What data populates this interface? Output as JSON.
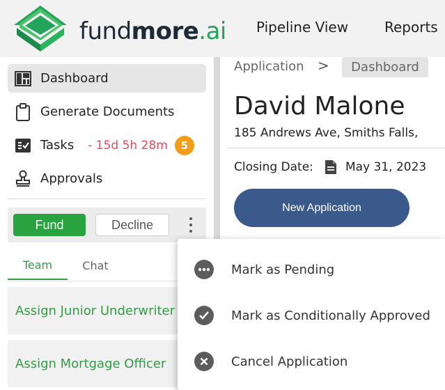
{
  "header": {
    "logo": {
      "word1": "fund",
      "word2": "more",
      "word3": ".ai"
    },
    "nav": {
      "pipeline": "Pipeline View",
      "reports": "Reports"
    }
  },
  "sidebar": {
    "items": [
      {
        "label": "Dashboard",
        "icon": "dashboard-icon"
      },
      {
        "label": "Generate Documents",
        "icon": "clipboard-icon"
      },
      {
        "label": "Tasks",
        "icon": "tasks-icon",
        "timer": "- 15d 5h 28m",
        "badge": "5"
      },
      {
        "label": "Approvals",
        "icon": "stamp-icon"
      }
    ],
    "actions": {
      "fund": "Fund",
      "decline": "Decline"
    },
    "tabs": {
      "team": "Team",
      "chat": "Chat"
    },
    "assign": [
      "Assign Junior Underwriter",
      "Assign Mortgage Officer"
    ]
  },
  "main": {
    "breadcrumb": {
      "first": "Application",
      "separator": ">",
      "current": "Dashboard"
    },
    "client_name": "David Malone",
    "address": "185 Andrews Ave, Smiths Falls,",
    "closing_label": "Closing Date:",
    "closing_date": "May 31, 2023",
    "new_application": "New Application"
  },
  "menu": {
    "items": [
      {
        "label": "Mark as Pending",
        "icon": "more-horizontal-icon"
      },
      {
        "label": "Mark as Conditionally Approved",
        "icon": "check-circle-icon"
      },
      {
        "label": "Cancel Application",
        "icon": "close-circle-icon"
      }
    ]
  },
  "colors": {
    "brand_green": "#22a55a",
    "fund_green": "#29a33f",
    "timer_red": "#e8495a",
    "badge_orange": "#f59c1a",
    "button_blue": "#3b5a8c"
  }
}
